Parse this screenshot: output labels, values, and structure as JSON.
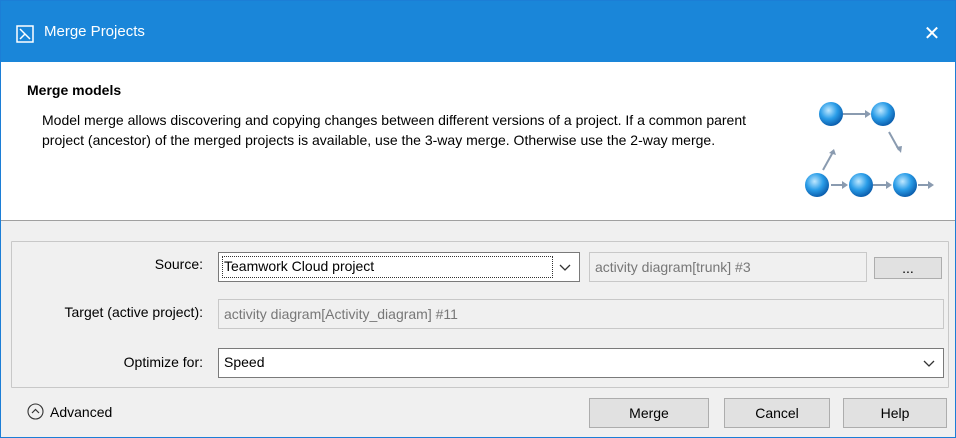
{
  "window": {
    "title": "Merge Projects",
    "close_glyph": "✕"
  },
  "header": {
    "heading": "Merge models",
    "description": "Model merge allows discovering and copying changes between different versions of a project. If a common parent project (ancestor) of the merged projects is available, use the 3-way merge. Otherwise use the 2-way merge.",
    "art_icon": "merge-flow-icon"
  },
  "form": {
    "source": {
      "label": "Source:",
      "type_value": "Teamwork Cloud project",
      "project_value": "activity diagram[trunk] #3",
      "browse_label": "..."
    },
    "target": {
      "label": "Target (active project):",
      "value": "activity diagram[Activity_diagram] #11"
    },
    "optimize": {
      "label": "Optimize for:",
      "value": "Speed"
    }
  },
  "footer": {
    "advanced_label": "Advanced",
    "merge_label": "Merge",
    "cancel_label": "Cancel",
    "help_label": "Help"
  },
  "colors": {
    "title_bar": "#1a86d9",
    "accent": "#1c7ed6"
  }
}
